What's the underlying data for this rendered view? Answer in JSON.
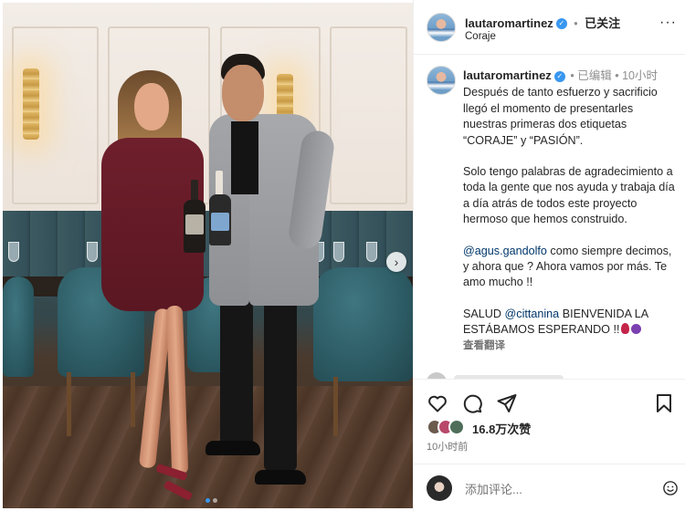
{
  "post": {
    "username": "lautaromartinez",
    "follow_label": "已关注",
    "location": "Coraje",
    "more_label": "···"
  },
  "caption": {
    "username": "lautaromartinez",
    "edited_label": "已编辑",
    "time_label": "10小时",
    "para1": "Después de tanto esfuerzo y sacrificio llegó el momento de presentarles nuestras primeras dos etiquetas “CORAJE” y “PASIÓN”.",
    "para2": "Solo tengo palabras de agradecimiento a toda la gente que nos ayuda y trabaja día a día atrás de todos este proyecto hermoso que hemos construido.",
    "mention1": "@agus.gandolfo",
    "para3_rest": " como siempre decimos, y ahora que ? Ahora vamos por más. Te amo mucho !!",
    "para4_lead": "SALUD ",
    "mention2": "@cittanina",
    "para4_rest": " BIENVENIDA LA ESTÁBAMOS ESPERANDO !!",
    "translate_label": "查看翻译"
  },
  "engagement": {
    "likes_label": "16.8万次赞",
    "time_label": "10小时前"
  },
  "comment_box": {
    "placeholder": "添加评论..."
  },
  "carousel": {
    "next_label": "›"
  },
  "icons": {
    "like": "heart-icon",
    "comment": "comment-bubble-icon",
    "share": "share-send-icon",
    "save": "bookmark-icon",
    "verified": "verified-badge-icon",
    "emoji": "emoji-smile-icon"
  },
  "colors": {
    "verified": "#3897f0",
    "mention": "#00376b",
    "muted": "#737373",
    "text": "#262626",
    "active_dot": "#3897f0"
  }
}
